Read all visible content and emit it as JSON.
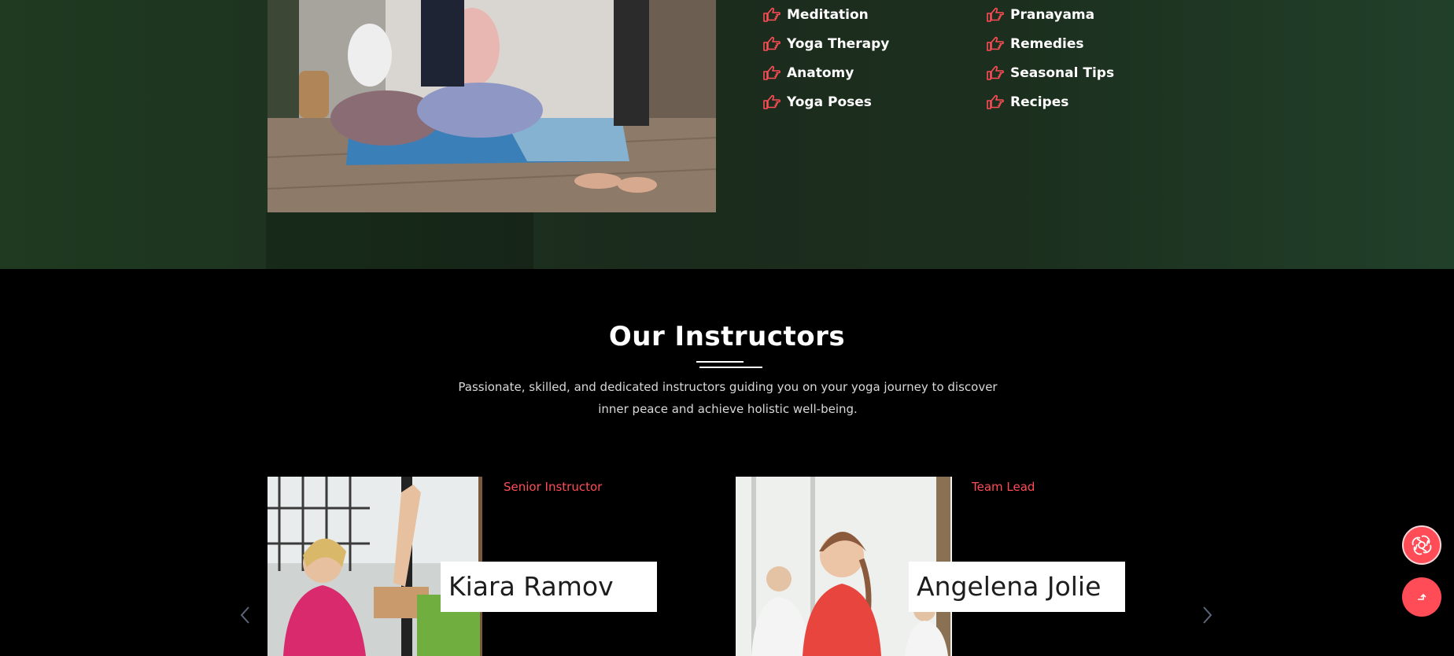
{
  "features": {
    "column_1": [
      {
        "label": "Meditation",
        "icon": "hand-point-right-icon"
      },
      {
        "label": "Yoga Therapy",
        "icon": "hand-point-right-icon"
      },
      {
        "label": "Anatomy",
        "icon": "hand-point-right-icon"
      },
      {
        "label": "Yoga Poses",
        "icon": "hand-point-right-icon"
      }
    ],
    "column_2": [
      {
        "label": "Pranayama",
        "icon": "hand-point-right-icon"
      },
      {
        "label": "Remedies",
        "icon": "hand-point-right-icon"
      },
      {
        "label": "Seasonal Tips",
        "icon": "hand-point-right-icon"
      },
      {
        "label": "Recipes",
        "icon": "hand-point-right-icon"
      }
    ]
  },
  "instructors_section": {
    "title": "Our Instructors",
    "description": "Passionate, skilled, and dedicated instructors guiding you on your yoga journey to discover inner peace and achieve holistic well-being.",
    "cards": [
      {
        "role": "Senior Instructor",
        "name": "Kiara Ramov"
      },
      {
        "role": "Team Lead",
        "name": "Angelena Jolie"
      }
    ]
  },
  "colors": {
    "accent": "#ff4c57",
    "section_green": "#1c2f1e",
    "background": "#000000"
  },
  "floating_buttons": {
    "chat_icon": "openai-chat-icon",
    "scroll_top_icon": "arrow-up-icon"
  }
}
